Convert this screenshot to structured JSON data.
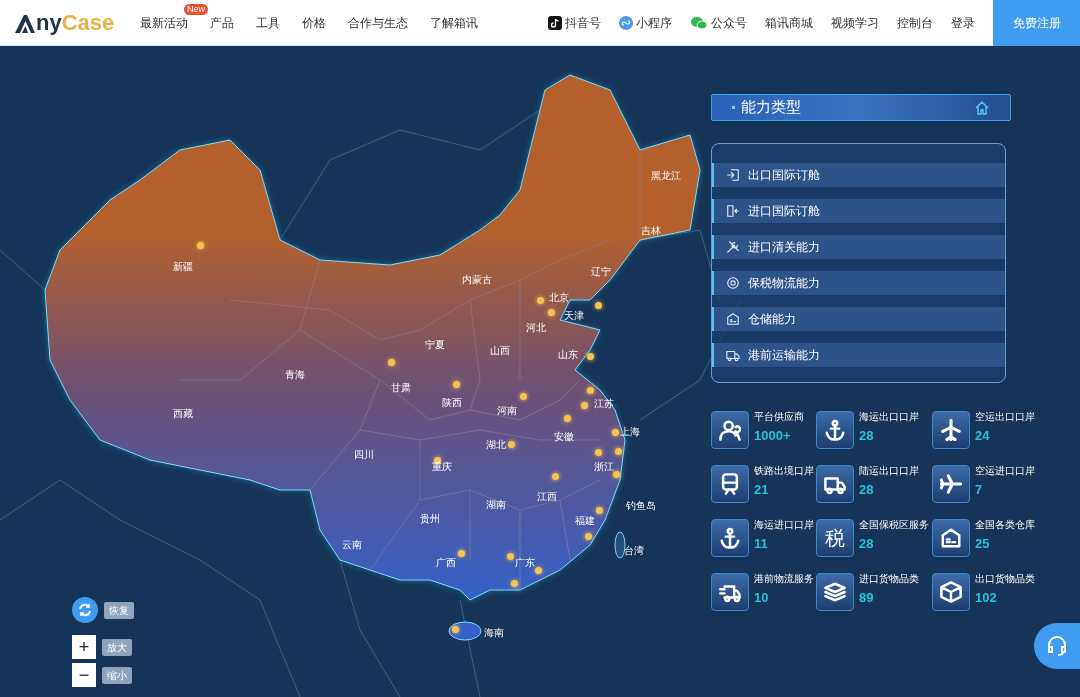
{
  "header": {
    "logo": {
      "dark": "ny",
      "accent": "Case"
    },
    "nav": [
      {
        "label": "最新活动",
        "badge": "New"
      },
      {
        "label": "产品"
      },
      {
        "label": "工具"
      },
      {
        "label": "价格"
      },
      {
        "label": "合作与生态"
      },
      {
        "label": "了解箱讯"
      }
    ],
    "social": [
      {
        "kind": "tiktok",
        "label": "抖音号"
      },
      {
        "kind": "miniapp",
        "label": "小程序"
      },
      {
        "kind": "wechat",
        "label": "公众号"
      }
    ],
    "links": [
      "箱讯商城",
      "视频学习",
      "控制台",
      "登录"
    ],
    "cta": "免费注册"
  },
  "map": {
    "regions": [
      "黑龙江",
      "吉林",
      "辽宁",
      "内蒙古",
      "新疆",
      "北京",
      "天津",
      "河北",
      "宁夏",
      "山西",
      "山东",
      "青海",
      "甘肃",
      "陕西",
      "河南",
      "江苏",
      "西藏",
      "上海",
      "安徽",
      "湖北",
      "四川",
      "重庆",
      "浙江",
      "江西",
      "湖南",
      "钓鱼岛",
      "贵州",
      "福建",
      "云南",
      "台湾",
      "广西",
      "广东",
      "海南"
    ],
    "controls": [
      {
        "kind": "reset",
        "tip": "恢复"
      },
      {
        "kind": "zoom-in",
        "glyph": "+",
        "tip": "放大"
      },
      {
        "kind": "zoom-out",
        "glyph": "−",
        "tip": "缩小"
      }
    ]
  },
  "panel": {
    "title": "能力类型",
    "items": [
      {
        "kind": "export",
        "label": "出口国际订舱"
      },
      {
        "kind": "import",
        "label": "进口国际订舱"
      },
      {
        "kind": "tools",
        "label": "进口清关能力"
      },
      {
        "kind": "tax",
        "label": "保税物流能力"
      },
      {
        "kind": "warehouse",
        "label": "仓储能力"
      },
      {
        "kind": "truck",
        "label": "港前运输能力"
      }
    ]
  },
  "stats": [
    {
      "kind": "users",
      "label": "平台供应商",
      "value": "1000+"
    },
    {
      "kind": "anchor",
      "label": "海运出口口岸",
      "value": "28"
    },
    {
      "kind": "plane",
      "label": "空运出口口岸",
      "value": "24"
    },
    {
      "kind": "train",
      "label": "铁路出境口岸",
      "value": "21"
    },
    {
      "kind": "truck",
      "label": "陆运出口口岸",
      "value": "28"
    },
    {
      "kind": "plane-land",
      "label": "空运进口口岸",
      "value": "7"
    },
    {
      "kind": "anchor",
      "label": "海运进口口岸",
      "value": "11"
    },
    {
      "kind": "text",
      "glyph": "税",
      "label": "全国保税区服务",
      "value": "28"
    },
    {
      "kind": "warehouse",
      "label": "全国各类仓库",
      "value": "25"
    },
    {
      "kind": "delivery",
      "label": "港前物流服务",
      "value": "10"
    },
    {
      "kind": "layers",
      "label": "进口货物品类",
      "value": "89"
    },
    {
      "kind": "box",
      "label": "出口货物品类",
      "value": "102"
    }
  ]
}
